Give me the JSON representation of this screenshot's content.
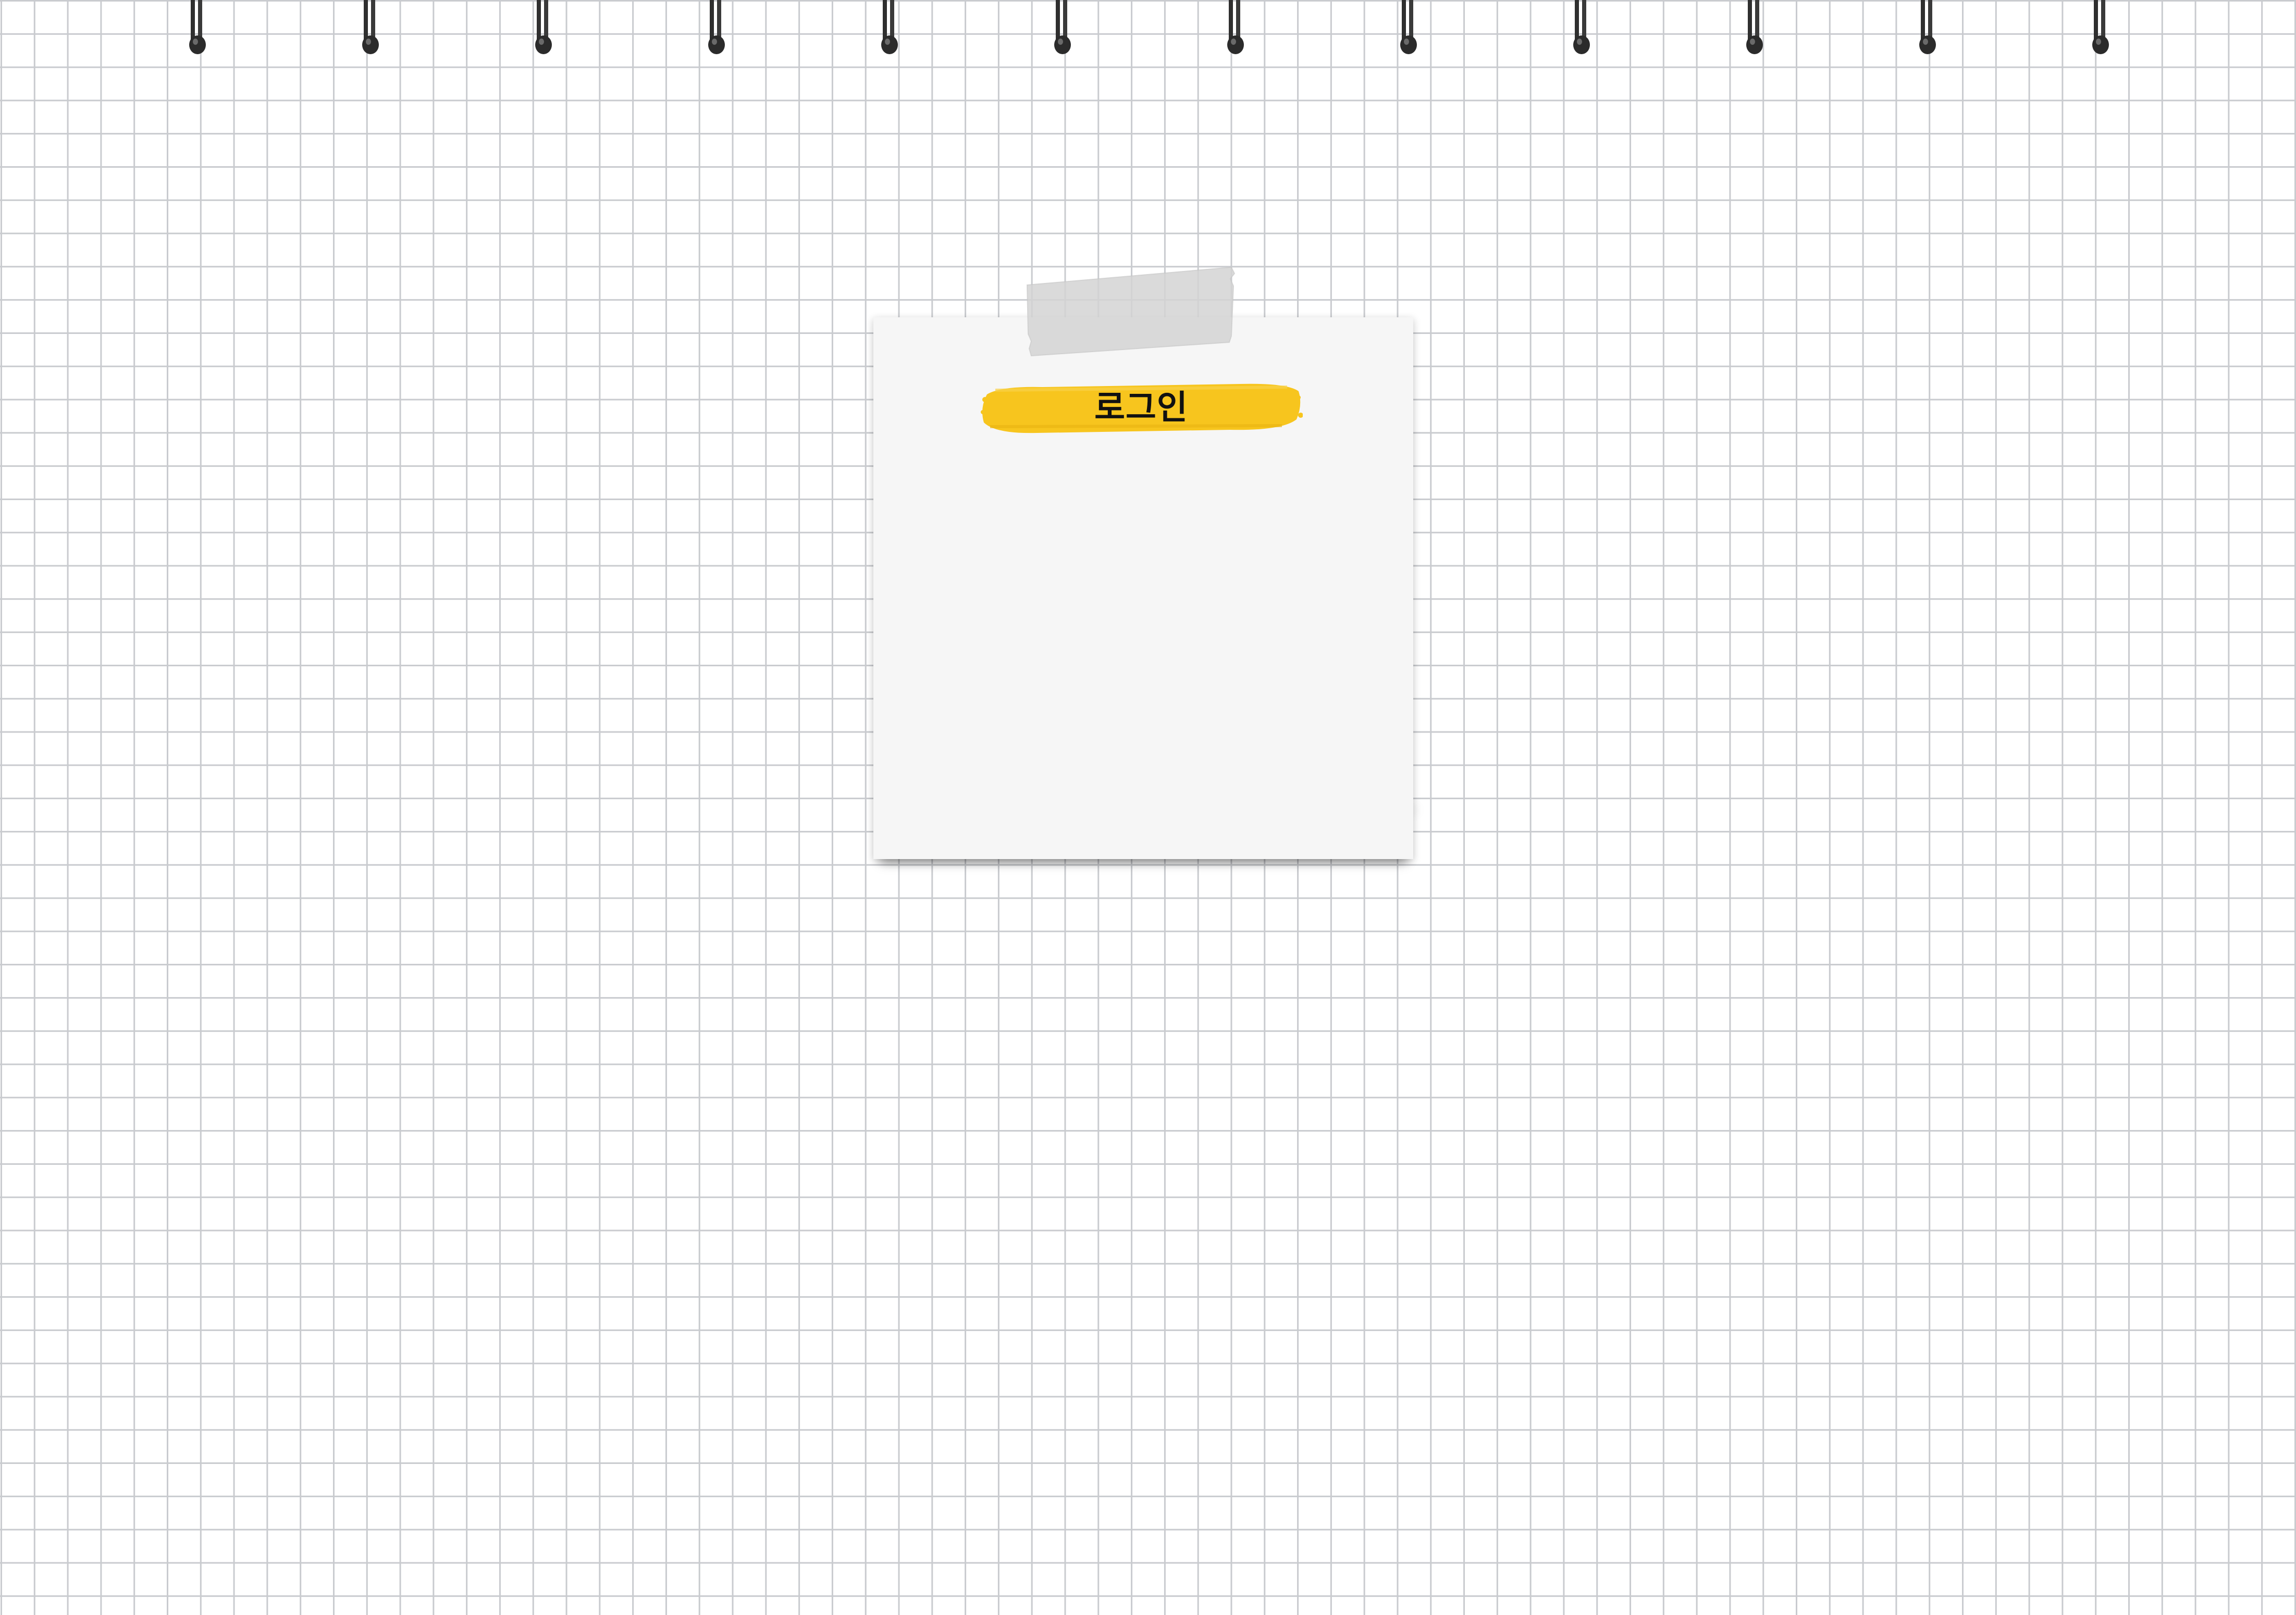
{
  "note": {
    "title": "로그인"
  },
  "colors": {
    "background": "#ffffff",
    "grid": "#c9cbcf",
    "note": "#f6f6f6",
    "highlight": "#f7c51e",
    "spiral": "#333333",
    "tape": "#d6d6d6"
  }
}
